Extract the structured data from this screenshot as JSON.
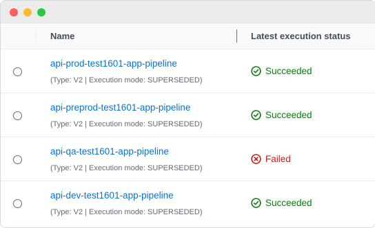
{
  "colors": {
    "link": "#0972d3",
    "success": "#037f0c",
    "error": "#d91515"
  },
  "table": {
    "columns": [
      "Name",
      "Latest execution status"
    ],
    "rows": [
      {
        "name": "api-prod-test1601-app-pipeline",
        "meta": "(Type: V2 | Execution mode: SUPERSEDED)",
        "status": "Succeeded",
        "status_icon": "check-circle-icon"
      },
      {
        "name": "api-preprod-test1601-app-pipeline",
        "meta": "(Type: V2 | Execution mode: SUPERSEDED)",
        "status": "Succeeded",
        "status_icon": "check-circle-icon"
      },
      {
        "name": "api-qa-test1601-app-pipeline",
        "meta": "(Type: V2 | Execution mode: SUPERSEDED)",
        "status": "Failed",
        "status_icon": "x-circle-icon"
      },
      {
        "name": "api-dev-test1601-app-pipeline",
        "meta": "(Type: V2 | Execution mode: SUPERSEDED)",
        "status": "Succeeded",
        "status_icon": "check-circle-icon"
      }
    ]
  }
}
